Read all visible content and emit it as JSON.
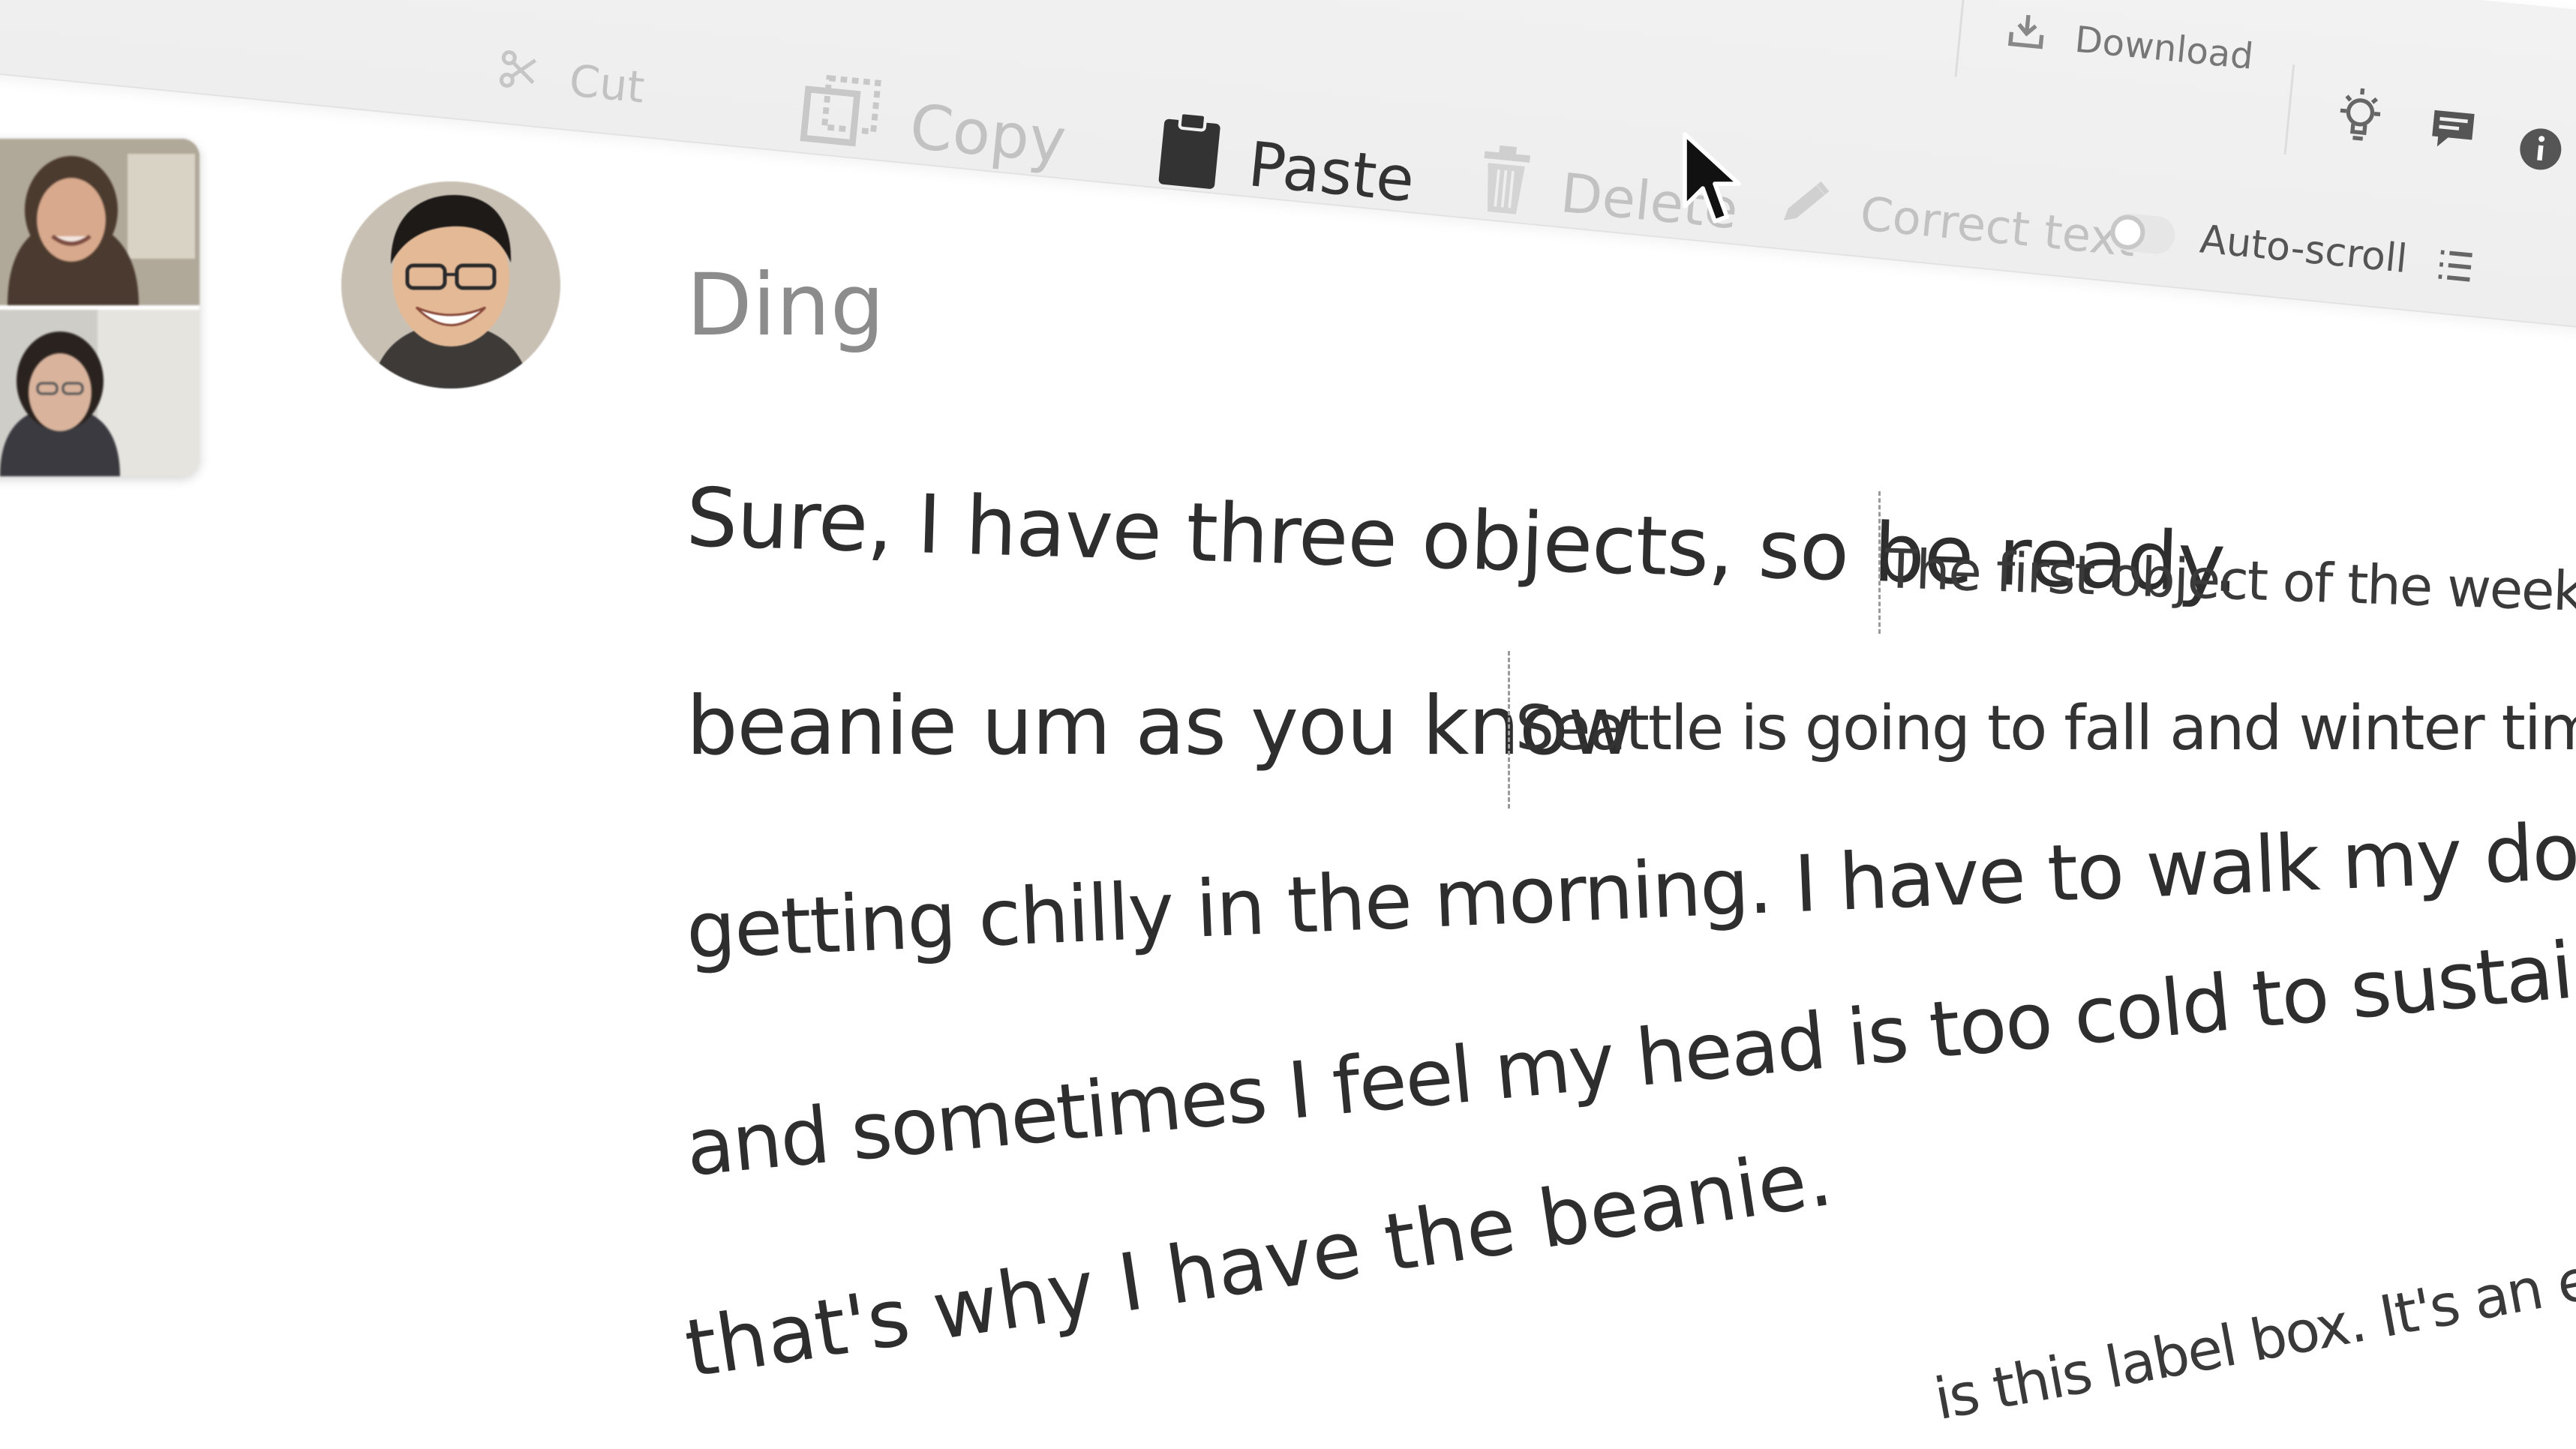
{
  "toolbar": {
    "cut_label": "Cut",
    "copy_label": "Copy",
    "paste_label": "Paste",
    "delete_label": "Delete",
    "correct_text_label": "Correct text",
    "autoscroll_label": "Auto-scroll",
    "download_label": "Download",
    "icons": [
      "scissors-icon",
      "copy-icon",
      "clipboard-icon",
      "trash-icon",
      "pencil-icon",
      "lightbulb-icon",
      "chat-icon",
      "info-icon",
      "list-icon",
      "download-icon"
    ]
  },
  "speaker": {
    "name": "Ding"
  },
  "transcript": {
    "line1_a": "Sure, I have three objects, so be ready.",
    "line1_b": "The first object of the week is my",
    "line2_a": "beanie um as you know",
    "line2_b": "Seattle is going to fall and winter time, and it's",
    "line3": "getting chilly in the morning. I have to walk my dog in the early morning",
    "line4": "and sometimes I feel my head is too cold to sustain that temperature. And",
    "line5": "that's why I have the beanie.",
    "line6_partial": "is this label box. It's an empty box right"
  },
  "colors": {
    "toolbar_bg": "#f0f0f0",
    "text_primary": "#2e2e2e",
    "text_muted": "#8c8c8c",
    "disabled": "#c2c2c2"
  }
}
